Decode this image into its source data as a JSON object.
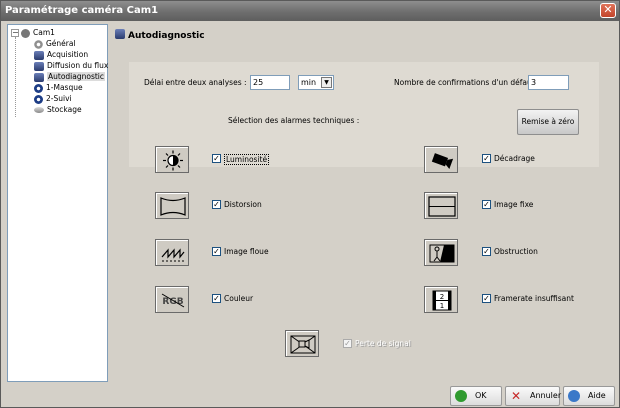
{
  "window": {
    "title": "Paramétrage caméra Cam1",
    "close_glyph": "✕"
  },
  "tree": {
    "root": "Cam1",
    "items": [
      {
        "label": "Général",
        "icon": "gear-icon"
      },
      {
        "label": "Acquisition",
        "icon": "camera-settings-icon"
      },
      {
        "label": "Diffusion du flux",
        "icon": "stream-icon"
      },
      {
        "label": "Autodiagnostic",
        "icon": "diagnostic-icon"
      },
      {
        "label": "1-Masque",
        "icon": "mask-icon"
      },
      {
        "label": "2-Suivi",
        "icon": "tracking-icon"
      },
      {
        "label": "Stockage",
        "icon": "storage-icon"
      }
    ],
    "selected": "Autodiagnostic"
  },
  "panel": {
    "title": "Autodiagnostic",
    "delay_label": "Délai entre deux analyses :",
    "delay_value": "25",
    "delay_unit": "min",
    "confirm_label": "Nombre de confirmations d'un défaut :",
    "confirm_value": "3",
    "alarms_label": "Sélection des alarmes techniques :",
    "reset_label": "Remise à zéro",
    "alarms": [
      {
        "label": "Luminosité",
        "checked": true,
        "icon": "brightness-icon"
      },
      {
        "label": "Décadrage",
        "checked": true,
        "icon": "camera-shift-icon"
      },
      {
        "label": "Distorsion",
        "checked": true,
        "icon": "distortion-icon"
      },
      {
        "label": "Image fixe",
        "checked": true,
        "icon": "frozen-image-icon"
      },
      {
        "label": "Image floue",
        "checked": true,
        "icon": "blur-icon"
      },
      {
        "label": "Obstruction",
        "checked": true,
        "icon": "obstruction-icon"
      },
      {
        "label": "Couleur",
        "checked": true,
        "icon": "color-icon"
      },
      {
        "label": "Framerate insuffisant",
        "checked": true,
        "icon": "framerate-icon"
      },
      {
        "label": "Perte de signal",
        "checked": true,
        "icon": "signal-loss-icon",
        "disabled": true
      }
    ],
    "framerate_digits": [
      "2",
      "1"
    ],
    "rgb_text": "RGB"
  },
  "footer": {
    "ok": "OK",
    "cancel": "Annuler",
    "help": "Aide"
  },
  "colors": {
    "ok": "#2f9a2f",
    "cancel": "#c62828",
    "help": "#3a78c8"
  }
}
